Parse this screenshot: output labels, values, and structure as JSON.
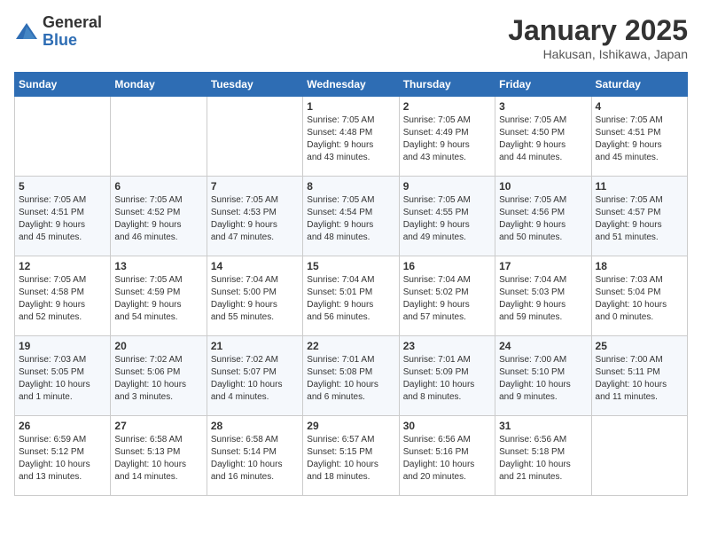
{
  "header": {
    "logo_general": "General",
    "logo_blue": "Blue",
    "title": "January 2025",
    "subtitle": "Hakusan, Ishikawa, Japan"
  },
  "days_of_week": [
    "Sunday",
    "Monday",
    "Tuesday",
    "Wednesday",
    "Thursday",
    "Friday",
    "Saturday"
  ],
  "weeks": [
    [
      {
        "day": "",
        "info": ""
      },
      {
        "day": "",
        "info": ""
      },
      {
        "day": "",
        "info": ""
      },
      {
        "day": "1",
        "info": "Sunrise: 7:05 AM\nSunset: 4:48 PM\nDaylight: 9 hours\nand 43 minutes."
      },
      {
        "day": "2",
        "info": "Sunrise: 7:05 AM\nSunset: 4:49 PM\nDaylight: 9 hours\nand 43 minutes."
      },
      {
        "day": "3",
        "info": "Sunrise: 7:05 AM\nSunset: 4:50 PM\nDaylight: 9 hours\nand 44 minutes."
      },
      {
        "day": "4",
        "info": "Sunrise: 7:05 AM\nSunset: 4:51 PM\nDaylight: 9 hours\nand 45 minutes."
      }
    ],
    [
      {
        "day": "5",
        "info": "Sunrise: 7:05 AM\nSunset: 4:51 PM\nDaylight: 9 hours\nand 45 minutes."
      },
      {
        "day": "6",
        "info": "Sunrise: 7:05 AM\nSunset: 4:52 PM\nDaylight: 9 hours\nand 46 minutes."
      },
      {
        "day": "7",
        "info": "Sunrise: 7:05 AM\nSunset: 4:53 PM\nDaylight: 9 hours\nand 47 minutes."
      },
      {
        "day": "8",
        "info": "Sunrise: 7:05 AM\nSunset: 4:54 PM\nDaylight: 9 hours\nand 48 minutes."
      },
      {
        "day": "9",
        "info": "Sunrise: 7:05 AM\nSunset: 4:55 PM\nDaylight: 9 hours\nand 49 minutes."
      },
      {
        "day": "10",
        "info": "Sunrise: 7:05 AM\nSunset: 4:56 PM\nDaylight: 9 hours\nand 50 minutes."
      },
      {
        "day": "11",
        "info": "Sunrise: 7:05 AM\nSunset: 4:57 PM\nDaylight: 9 hours\nand 51 minutes."
      }
    ],
    [
      {
        "day": "12",
        "info": "Sunrise: 7:05 AM\nSunset: 4:58 PM\nDaylight: 9 hours\nand 52 minutes."
      },
      {
        "day": "13",
        "info": "Sunrise: 7:05 AM\nSunset: 4:59 PM\nDaylight: 9 hours\nand 54 minutes."
      },
      {
        "day": "14",
        "info": "Sunrise: 7:04 AM\nSunset: 5:00 PM\nDaylight: 9 hours\nand 55 minutes."
      },
      {
        "day": "15",
        "info": "Sunrise: 7:04 AM\nSunset: 5:01 PM\nDaylight: 9 hours\nand 56 minutes."
      },
      {
        "day": "16",
        "info": "Sunrise: 7:04 AM\nSunset: 5:02 PM\nDaylight: 9 hours\nand 57 minutes."
      },
      {
        "day": "17",
        "info": "Sunrise: 7:04 AM\nSunset: 5:03 PM\nDaylight: 9 hours\nand 59 minutes."
      },
      {
        "day": "18",
        "info": "Sunrise: 7:03 AM\nSunset: 5:04 PM\nDaylight: 10 hours\nand 0 minutes."
      }
    ],
    [
      {
        "day": "19",
        "info": "Sunrise: 7:03 AM\nSunset: 5:05 PM\nDaylight: 10 hours\nand 1 minute."
      },
      {
        "day": "20",
        "info": "Sunrise: 7:02 AM\nSunset: 5:06 PM\nDaylight: 10 hours\nand 3 minutes."
      },
      {
        "day": "21",
        "info": "Sunrise: 7:02 AM\nSunset: 5:07 PM\nDaylight: 10 hours\nand 4 minutes."
      },
      {
        "day": "22",
        "info": "Sunrise: 7:01 AM\nSunset: 5:08 PM\nDaylight: 10 hours\nand 6 minutes."
      },
      {
        "day": "23",
        "info": "Sunrise: 7:01 AM\nSunset: 5:09 PM\nDaylight: 10 hours\nand 8 minutes."
      },
      {
        "day": "24",
        "info": "Sunrise: 7:00 AM\nSunset: 5:10 PM\nDaylight: 10 hours\nand 9 minutes."
      },
      {
        "day": "25",
        "info": "Sunrise: 7:00 AM\nSunset: 5:11 PM\nDaylight: 10 hours\nand 11 minutes."
      }
    ],
    [
      {
        "day": "26",
        "info": "Sunrise: 6:59 AM\nSunset: 5:12 PM\nDaylight: 10 hours\nand 13 minutes."
      },
      {
        "day": "27",
        "info": "Sunrise: 6:58 AM\nSunset: 5:13 PM\nDaylight: 10 hours\nand 14 minutes."
      },
      {
        "day": "28",
        "info": "Sunrise: 6:58 AM\nSunset: 5:14 PM\nDaylight: 10 hours\nand 16 minutes."
      },
      {
        "day": "29",
        "info": "Sunrise: 6:57 AM\nSunset: 5:15 PM\nDaylight: 10 hours\nand 18 minutes."
      },
      {
        "day": "30",
        "info": "Sunrise: 6:56 AM\nSunset: 5:16 PM\nDaylight: 10 hours\nand 20 minutes."
      },
      {
        "day": "31",
        "info": "Sunrise: 6:56 AM\nSunset: 5:18 PM\nDaylight: 10 hours\nand 21 minutes."
      },
      {
        "day": "",
        "info": ""
      }
    ]
  ]
}
